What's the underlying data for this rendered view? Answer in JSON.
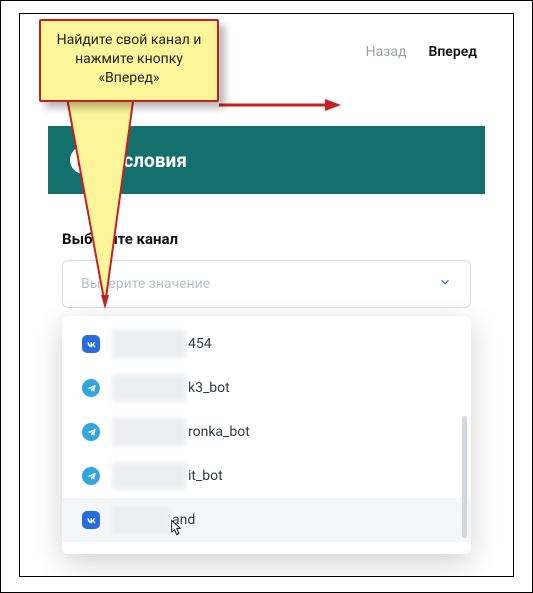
{
  "nav": {
    "back": "Назад",
    "next": "Вперед"
  },
  "section": {
    "title": "Условия",
    "label": "Выберите канал"
  },
  "select": {
    "placeholder": "Выберите значение"
  },
  "callout": {
    "text": "Найдите свой канал и нажмите кнопку «Вперед»"
  },
  "dropdown": {
    "items": [
      {
        "platform": "vk",
        "blur_w": 74,
        "suffix": "454"
      },
      {
        "platform": "tg",
        "blur_w": 74,
        "suffix": "k3_bot"
      },
      {
        "platform": "tg",
        "blur_w": 74,
        "suffix": "ronka_bot"
      },
      {
        "platform": "tg",
        "blur_w": 74,
        "suffix": "it_bot"
      },
      {
        "platform": "vk",
        "blur_w": 58,
        "suffix": "and"
      }
    ]
  }
}
